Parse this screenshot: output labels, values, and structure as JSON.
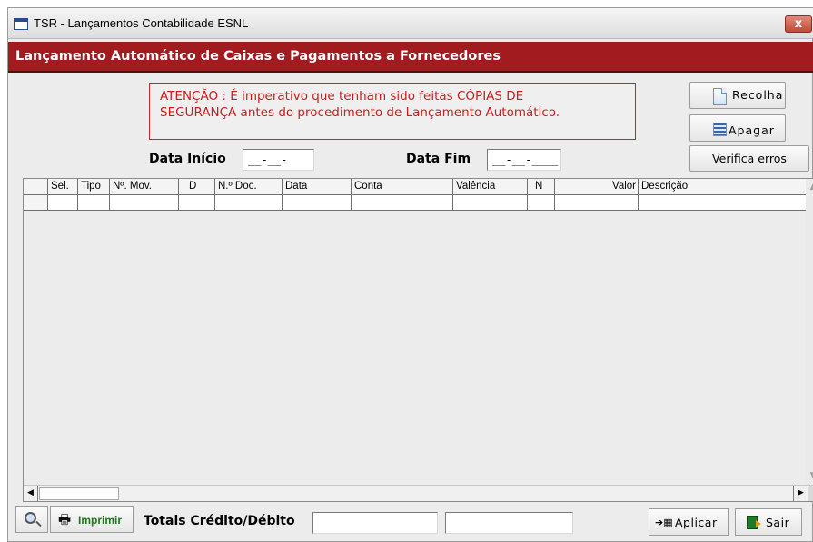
{
  "window": {
    "title": "TSR - Lançamentos Contabilidade ESNL",
    "close_label": "x"
  },
  "banner": {
    "title": "Lançamento Automático de Caixas e Pagamentos a Fornecedores"
  },
  "warning": {
    "line1": "ATENÇÃO : É imperativo que tenham sido feitas CÓPIAS DE",
    "line2": "SEGURANÇA antes do  procedimento de Lançamento Automático."
  },
  "buttons": {
    "recolha": "Recolha",
    "apagar": "Apagar",
    "verifica": "Verifica erros",
    "imprimir": "Imprimir",
    "aplicar": "Aplicar",
    "sair": "Sair"
  },
  "dates": {
    "inicio_label": "Data Início",
    "inicio_value": "__-__-____",
    "fim_label": "Data Fim",
    "fim_value": "__-__-____"
  },
  "grid": {
    "columns": [
      "Sel.",
      "Tipo",
      "Nº. Mov.",
      "D",
      "N.º Doc.",
      "Data",
      "Conta",
      "Valência",
      "N",
      "Valor",
      "Descrição"
    ],
    "rows": []
  },
  "totals": {
    "label": "Totais Crédito/Débito",
    "credito": "",
    "debito": ""
  },
  "icons": {
    "app": "app-window-icon",
    "recolha": "document-icon",
    "apagar": "list-icon",
    "search": "magnifier-icon",
    "print": "printer-icon",
    "aplicar": "apply-icon",
    "sair": "exit-door-icon"
  },
  "colors": {
    "banner": "#a11b1f",
    "warning_text": "#c81e1e",
    "print_label": "#1a7a1a"
  }
}
